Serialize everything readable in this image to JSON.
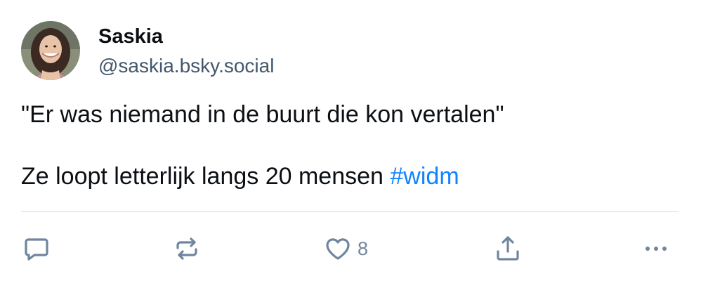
{
  "post": {
    "author": {
      "display_name": "Saskia",
      "handle": "@saskia.bsky.social"
    },
    "text": {
      "line1": "\"Er was niemand in de buurt die kon vertalen\"",
      "line2_prefix": "Ze loopt letterlijk langs 20 mensen ",
      "hashtag": "#widm"
    },
    "actions": {
      "reply_icon": "speech-bubble-icon",
      "repost_icon": "repost-arrows-icon",
      "like_icon": "heart-icon",
      "like_count": "8",
      "share_icon": "share-upload-icon",
      "more_icon": "ellipsis-icon"
    }
  },
  "colors": {
    "text": "#0b0f14",
    "handle": "#42576c",
    "hashtag": "#1083fe",
    "icon": "#6f869f",
    "divider": "#d4dbe2"
  }
}
